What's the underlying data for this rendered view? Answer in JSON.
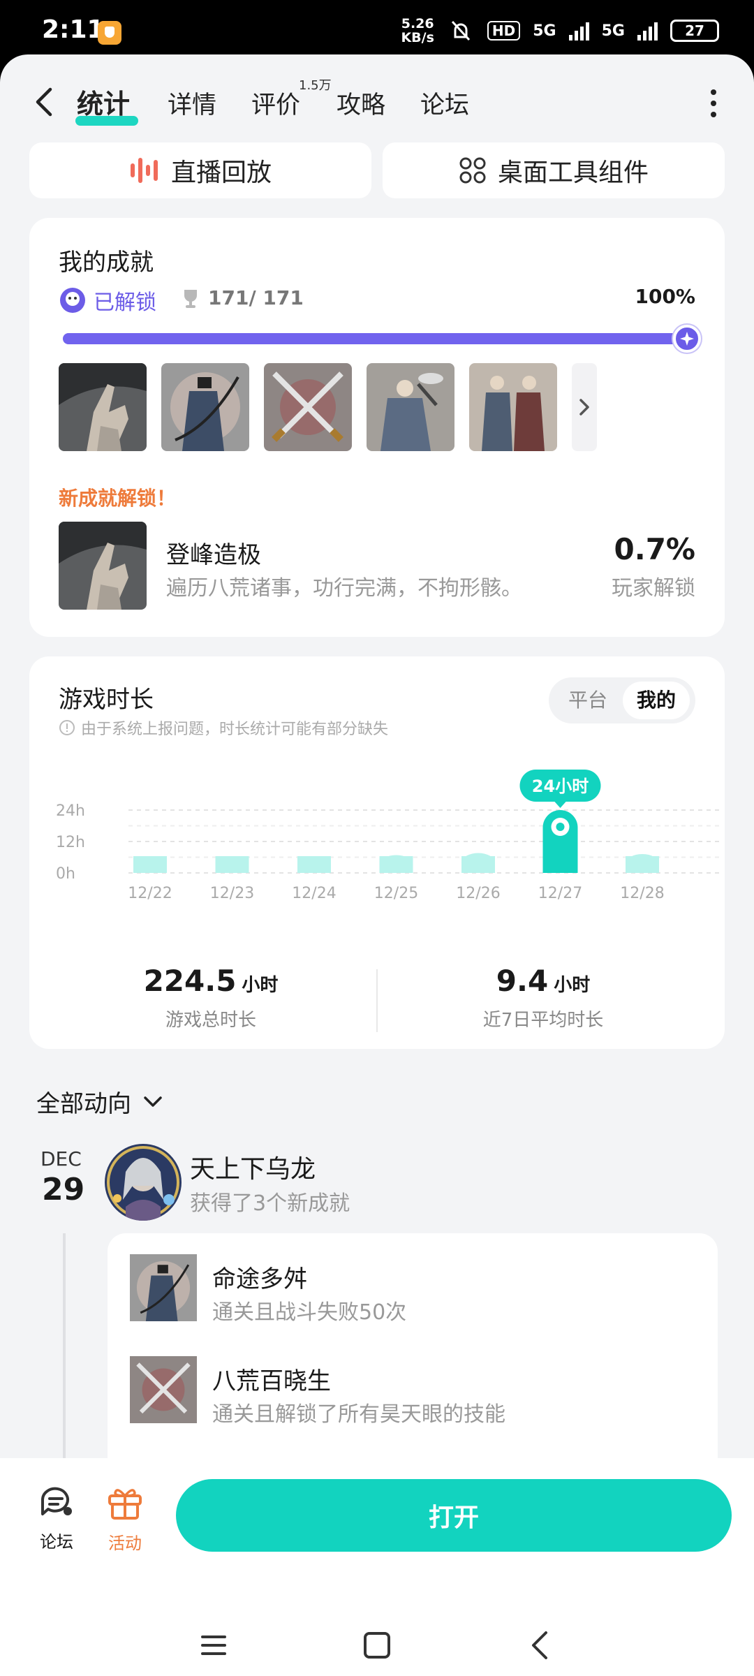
{
  "status_bar": {
    "time": "2:11",
    "speed_value": "5.26",
    "speed_unit": "KB/s",
    "hd": "HD",
    "net1": "5G",
    "net2": "5G",
    "battery": "27"
  },
  "nav": {
    "tabs": [
      {
        "label": "统计",
        "active": true
      },
      {
        "label": "详情"
      },
      {
        "label": "评价",
        "badge": "1.5万"
      },
      {
        "label": "攻略"
      },
      {
        "label": "论坛"
      }
    ]
  },
  "quick": {
    "replay": "直播回放",
    "widget": "桌面工具组件"
  },
  "achievements": {
    "title": "我的成就",
    "unlocked": "已解锁",
    "count": "171/ 171",
    "percent_text": "100%",
    "progress": 1.0,
    "new_title": "新成就解锁！",
    "new_name": "登峰造极",
    "new_desc": "遍历八荒诸事，功行完满，不拘形骸。",
    "new_pct": "0.7%",
    "new_pct_label": "玩家解锁"
  },
  "playtime": {
    "title": "游戏时长",
    "notice": "由于系统上报问题，时长统计可能有部分缺失",
    "toggle": [
      "平台",
      "我的"
    ],
    "total_value": "224.5",
    "total_unit": "小时",
    "total_label": "游戏总时长",
    "avg_value": "9.4",
    "avg_unit": "小时",
    "avg_label": "近7日平均时长"
  },
  "chart_data": {
    "type": "bar",
    "categories": [
      "12/22",
      "12/23",
      "12/24",
      "12/25",
      "12/26",
      "12/27",
      "12/28"
    ],
    "values": [
      5.6,
      2.6,
      5.6,
      6.8,
      7.6,
      24,
      7.2
    ],
    "y_ticks": [
      "24h",
      "12h",
      "0h"
    ],
    "ylim": [
      0,
      24
    ],
    "highlight_index": 5,
    "highlight_label": "24小时",
    "grid": true,
    "colors": {
      "bar": "#b8f3ec",
      "highlight": "#12d3bf"
    }
  },
  "feed": {
    "filter": "全部动向",
    "month": "DEC",
    "day": "29",
    "user": "天上下乌龙",
    "summary": "获得了3个新成就",
    "items": [
      {
        "name": "命途多舛",
        "desc": "通关且战斗失败50次"
      },
      {
        "name": "八荒百晓生",
        "desc": "通关且解锁了所有昊天眼的技能"
      }
    ]
  },
  "bottom": {
    "forum": "论坛",
    "activity": "活动",
    "open": "打开"
  }
}
